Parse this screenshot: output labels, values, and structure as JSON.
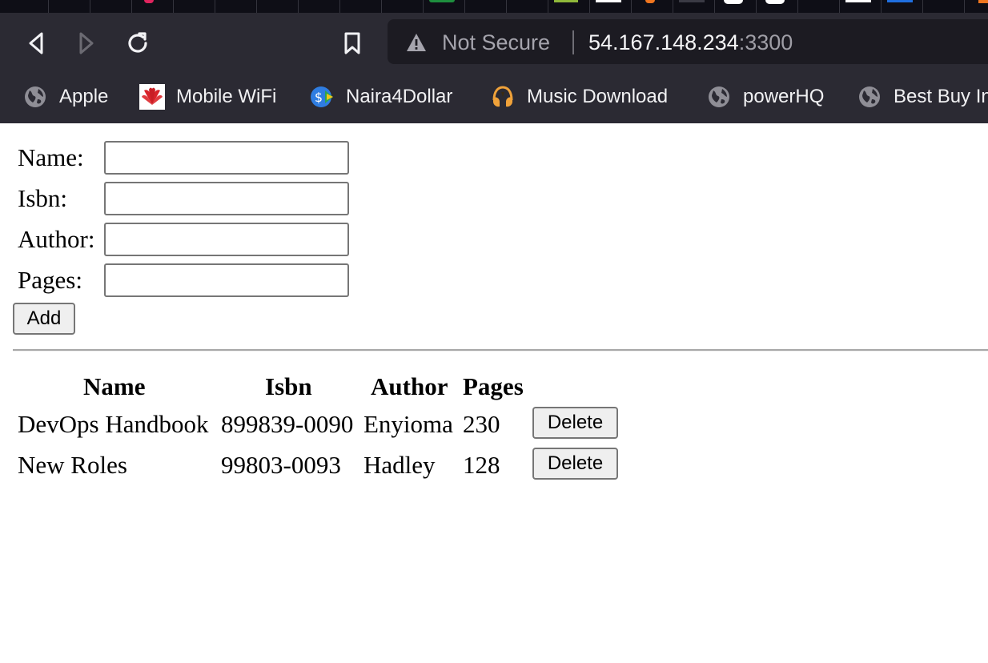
{
  "browser": {
    "url_bar": {
      "security_label": "Not Secure",
      "host": "54.167.148.234",
      "port": ":3300"
    },
    "bookmarks": [
      {
        "label": "Apple",
        "icon": "globe-icon"
      },
      {
        "label": "Mobile WiFi",
        "icon": "huawei-icon"
      },
      {
        "label": "Naira4Dollar",
        "icon": "naira-icon"
      },
      {
        "label": "Music Download",
        "icon": "headphones-icon"
      },
      {
        "label": "powerHQ",
        "icon": "globe-icon"
      },
      {
        "label": "Best Buy In",
        "icon": "globe-icon"
      }
    ]
  },
  "form": {
    "fields": [
      {
        "label": "Name:",
        "value": ""
      },
      {
        "label": "Isbn:",
        "value": ""
      },
      {
        "label": "Author:",
        "value": ""
      },
      {
        "label": "Pages:",
        "value": ""
      }
    ],
    "add_label": "Add"
  },
  "table": {
    "headers": [
      "Name",
      "Isbn",
      "Author",
      "Pages"
    ],
    "rows": [
      {
        "name": "DevOps Handbook",
        "isbn": "899839-0090",
        "author": "Enyioma",
        "pages": "230",
        "action": "Delete"
      },
      {
        "name": "New Roles",
        "isbn": "99803-0093",
        "author": "Hadley",
        "pages": "128",
        "action": "Delete"
      }
    ]
  }
}
